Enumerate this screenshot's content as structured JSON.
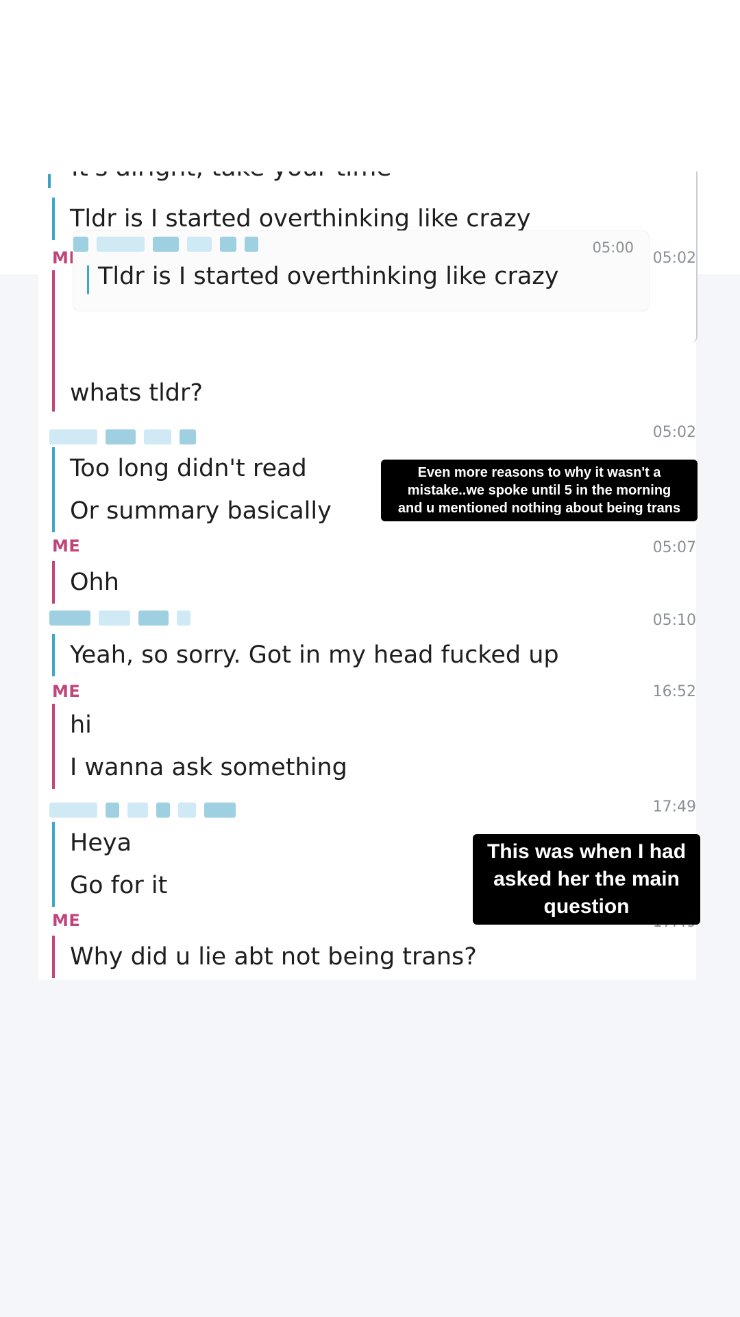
{
  "chat": {
    "cut_line": "It's alright, take your time",
    "messages": [
      {
        "sender": "",
        "time": "",
        "lines": [
          "Tldr is I started overthinking like crazy"
        ]
      },
      {
        "sender": "ME",
        "time": "05:02",
        "quote": {
          "time": "05:00",
          "text": "Tldr is I started overthinking like crazy"
        },
        "lines": [
          "whats tldr?"
        ]
      },
      {
        "sender": "",
        "time": "05:02",
        "lines": [
          "Too long didn't read",
          "Or summary basically"
        ]
      },
      {
        "sender": "ME",
        "time": "05:07",
        "lines": [
          "Ohh"
        ]
      },
      {
        "sender": "",
        "time": "05:10",
        "lines": [
          "Yeah, so sorry. Got in my head fucked up"
        ]
      },
      {
        "sender": "ME",
        "time": "16:52",
        "lines": [
          "hi",
          "I wanna ask something"
        ]
      },
      {
        "sender": "",
        "time": "17:49",
        "lines": [
          "Heya",
          "Go for it"
        ]
      },
      {
        "sender": "ME",
        "time": "17:49",
        "lines": [
          "Why did u lie abt not being trans?"
        ]
      }
    ]
  },
  "captions": {
    "first": [
      "Even more reasons to why it wasn't a",
      "mistake..we spoke until 5 in the morning",
      "and u mentioned nothing about being trans"
    ],
    "second": [
      "This was when I had",
      "asked her the main",
      "question"
    ]
  },
  "colors": {
    "me": "#c0457a",
    "friend": "#3ea6c8",
    "caption_bg": "#000000"
  }
}
